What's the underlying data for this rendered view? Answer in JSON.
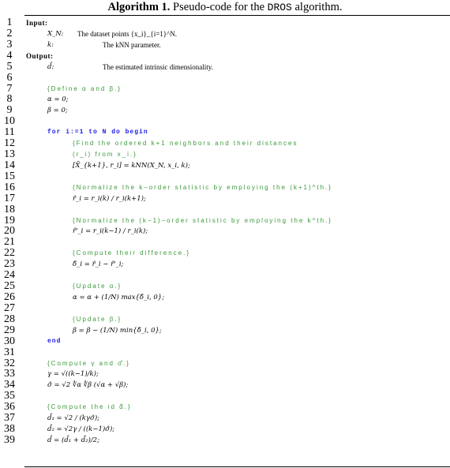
{
  "caption": {
    "label": "Algorithm 1.",
    "text_before": " Pseudo-code for the ",
    "algo_name": "DROS",
    "text_after": " algorithm."
  },
  "lines": [
    {
      "n": "1",
      "text": "Input:"
    },
    {
      "n": "2",
      "text": "X_N:",
      "desc": "The dataset points {x_i}_{i=1}^N."
    },
    {
      "n": "3",
      "text": "k:",
      "desc": "The kNN parameter."
    },
    {
      "n": "4",
      "text": "Output:"
    },
    {
      "n": "5",
      "text": "d̂:",
      "desc": "The estimated intrinsic dimensionality."
    },
    {
      "n": "6",
      "text": ""
    },
    {
      "n": "7",
      "text": "{Define α and β.}"
    },
    {
      "n": "8",
      "text": "α = 0;"
    },
    {
      "n": "9",
      "text": "β = 0;"
    },
    {
      "n": "10",
      "text": ""
    },
    {
      "n": "11",
      "text": "for i:=1 to N do begin"
    },
    {
      "n": "12",
      "text": "{Find the ordered k+1 neighbors and their distances"
    },
    {
      "n": "13",
      "text": "(r_i) from x_i.}"
    },
    {
      "n": "14",
      "text": "[X̄_{k+1}, r_i] = kNN(X_N, x_i, k);"
    },
    {
      "n": "15",
      "text": ""
    },
    {
      "n": "16",
      "text": "{Normalize the k–order statistic by employing the (k+1)^th.}"
    },
    {
      "n": "17",
      "text": "r̂_i = r_i(k) / r_i(k+1);"
    },
    {
      "n": "18",
      "text": ""
    },
    {
      "n": "19",
      "text": "{Normalize the (k−1)–order statistic by employing the k^th.}"
    },
    {
      "n": "20",
      "text": "r̂'_i = r_i(k−1) / r_i(k);"
    },
    {
      "n": "21",
      "text": ""
    },
    {
      "n": "22",
      "text": "{Compute their difference.}"
    },
    {
      "n": "23",
      "text": "δ̂_i = r̂_i − r̂'_i;"
    },
    {
      "n": "24",
      "text": ""
    },
    {
      "n": "25",
      "text": "{Update α.}"
    },
    {
      "n": "26",
      "text": "α = α + (1/N) max{δ̂_i, 0};"
    },
    {
      "n": "27",
      "text": ""
    },
    {
      "n": "28",
      "text": "{Update β.}"
    },
    {
      "n": "29",
      "text": "β = β − (1/N) min{δ̂_i, 0};"
    },
    {
      "n": "30",
      "text": "end"
    },
    {
      "n": "31",
      "text": ""
    },
    {
      "n": "32",
      "text": "{Compute γ and σ̂.}"
    },
    {
      "n": "33",
      "text": "γ = √((k−1)/k);"
    },
    {
      "n": "34",
      "text": "σ̂ = √2 ∜α ∜β (√α + √β);"
    },
    {
      "n": "35",
      "text": ""
    },
    {
      "n": "36",
      "text": "{Compute the id d̂.}"
    },
    {
      "n": "37",
      "text": "d̂₁ = √2 / (kγσ̂);"
    },
    {
      "n": "38",
      "text": "d̂₂ = √2γ / ((k−1)σ̂);"
    },
    {
      "n": "39",
      "text": "d̂ = (d̂₁ + d̂₂)/2;"
    }
  ],
  "colors": {
    "comment": "#3a9a3a",
    "keyword": "#1a1ae6",
    "text": "#000000"
  }
}
